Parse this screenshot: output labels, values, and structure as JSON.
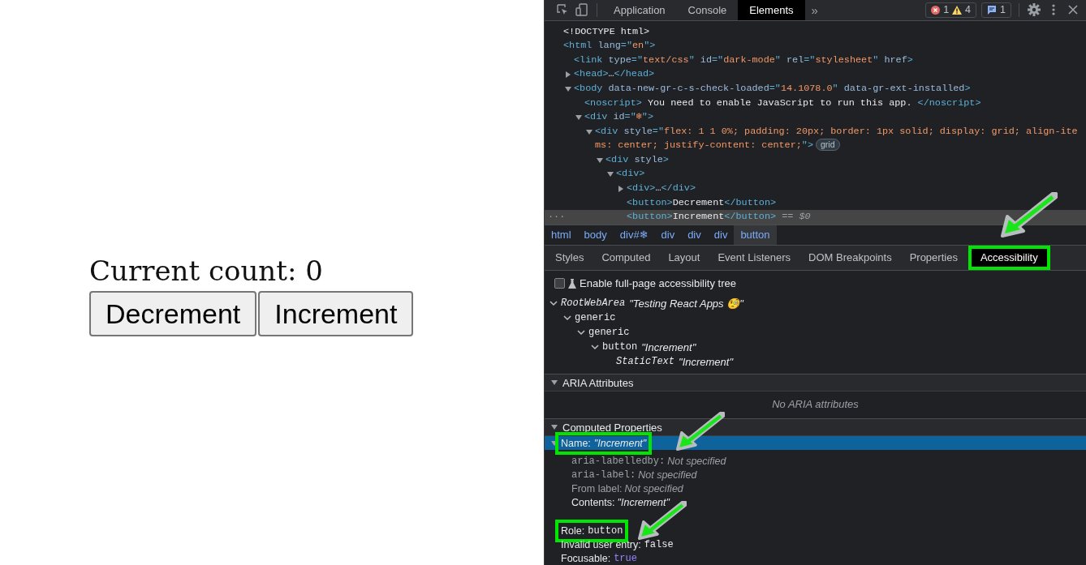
{
  "app": {
    "count_text": "Current count: 0",
    "buttons": [
      {
        "label": "Decrement"
      },
      {
        "label": "Increment"
      }
    ]
  },
  "devtools": {
    "tabs": [
      {
        "label": "Application",
        "selected": false
      },
      {
        "label": "Console",
        "selected": false
      },
      {
        "label": "Elements",
        "selected": true
      }
    ],
    "more_tabs": "»",
    "issues": {
      "errors": "1",
      "warnings": "4",
      "messages": "1"
    },
    "dom_tree": [
      {
        "parts": [
          {
            "kind": "text",
            "text": "<!DOCTYPE html>"
          }
        ]
      },
      {
        "parts": [
          {
            "kind": "tag",
            "text": "<html"
          },
          {
            "kind": "attr",
            "text": " lang"
          },
          {
            "kind": "tag",
            "text": "=\""
          },
          {
            "kind": "value",
            "text": "en"
          },
          {
            "kind": "tag",
            "text": "\">"
          }
        ],
        "children": [
          {
            "parts": [
              {
                "kind": "tag",
                "text": "<link"
              },
              {
                "kind": "attr",
                "text": " type"
              },
              {
                "kind": "tag",
                "text": "=\""
              },
              {
                "kind": "value",
                "text": "text/css"
              },
              {
                "kind": "tag",
                "text": "\""
              },
              {
                "kind": "attr",
                "text": " id"
              },
              {
                "kind": "tag",
                "text": "=\""
              },
              {
                "kind": "value",
                "text": "dark-mode"
              },
              {
                "kind": "tag",
                "text": "\""
              },
              {
                "kind": "attr",
                "text": " rel"
              },
              {
                "kind": "tag",
                "text": "=\""
              },
              {
                "kind": "value",
                "text": "stylesheet"
              },
              {
                "kind": "tag",
                "text": "\""
              },
              {
                "kind": "attr",
                "text": " href"
              },
              {
                "kind": "tag",
                "text": ">"
              }
            ]
          },
          {
            "expanded": false,
            "parts": [
              {
                "kind": "tag",
                "text": "<head>"
              },
              {
                "kind": "text",
                "text": "…"
              },
              {
                "kind": "tag",
                "text": "</head>"
              }
            ]
          },
          {
            "expanded": true,
            "parts": [
              {
                "kind": "tag",
                "text": "<body"
              },
              {
                "kind": "attr",
                "text": " data-new-gr-c-s-check-loaded"
              },
              {
                "kind": "tag",
                "text": "=\""
              },
              {
                "kind": "value",
                "text": "14.1078.0"
              },
              {
                "kind": "tag",
                "text": "\""
              },
              {
                "kind": "attr",
                "text": " data-gr-ext-installed"
              },
              {
                "kind": "tag",
                "text": ">"
              }
            ],
            "children": [
              {
                "parts": [
                  {
                    "kind": "tag",
                    "text": "<noscript>"
                  },
                  {
                    "kind": "text",
                    "text": " You need to enable JavaScript to run this app. "
                  },
                  {
                    "kind": "tag",
                    "text": "</noscript>"
                  }
                ]
              },
              {
                "expanded": true,
                "parts": [
                  {
                    "kind": "tag",
                    "text": "<div"
                  },
                  {
                    "kind": "attr",
                    "text": " id"
                  },
                  {
                    "kind": "tag",
                    "text": "=\""
                  },
                  {
                    "kind": "value",
                    "text": "❄"
                  },
                  {
                    "kind": "tag",
                    "text": "\">"
                  }
                ],
                "children": [
                  {
                    "expanded": true,
                    "parts": [
                      {
                        "kind": "tag",
                        "text": "<div"
                      },
                      {
                        "kind": "attr",
                        "text": " style"
                      },
                      {
                        "kind": "tag",
                        "text": "=\""
                      },
                      {
                        "kind": "value",
                        "text": "flex: 1 1 0%; padding: 20px; border: 1px solid; display: grid; align-items: center; justify-content: center;"
                      },
                      {
                        "kind": "tag",
                        "text": "\">"
                      },
                      {
                        "kind": "badge",
                        "text": "grid"
                      }
                    ],
                    "children": [
                      {
                        "expanded": true,
                        "parts": [
                          {
                            "kind": "tag",
                            "text": "<div"
                          },
                          {
                            "kind": "attr",
                            "text": " style"
                          },
                          {
                            "kind": "tag",
                            "text": ">"
                          }
                        ],
                        "children": [
                          {
                            "expanded": true,
                            "parts": [
                              {
                                "kind": "tag",
                                "text": "<div>"
                              }
                            ],
                            "children": [
                              {
                                "expanded": false,
                                "parts": [
                                  {
                                    "kind": "tag",
                                    "text": "<div>"
                                  },
                                  {
                                    "kind": "text",
                                    "text": "…"
                                  },
                                  {
                                    "kind": "tag",
                                    "text": "</div>"
                                  }
                                ]
                              },
                              {
                                "parts": [
                                  {
                                    "kind": "tag",
                                    "text": "<button>"
                                  },
                                  {
                                    "kind": "text",
                                    "text": "Decrement"
                                  },
                                  {
                                    "kind": "tag",
                                    "text": "</button>"
                                  }
                                ]
                              },
                              {
                                "selected": true,
                                "gutter": "···",
                                "parts": [
                                  {
                                    "kind": "tag",
                                    "text": "<button>"
                                  },
                                  {
                                    "kind": "text",
                                    "text": "Increment"
                                  },
                                  {
                                    "kind": "tag",
                                    "text": "</button>"
                                  },
                                  {
                                    "kind": "dim",
                                    "text": " == $0"
                                  }
                                ]
                              }
                            ]
                          }
                        ]
                      }
                    ]
                  }
                ]
              }
            ]
          }
        ]
      }
    ],
    "breadcrumbs": [
      {
        "label": "html",
        "selected": false
      },
      {
        "label": "body",
        "selected": false
      },
      {
        "label": "div#❄",
        "selected": false
      },
      {
        "label": "div",
        "selected": false
      },
      {
        "label": "div",
        "selected": false
      },
      {
        "label": "div",
        "selected": false
      },
      {
        "label": "button",
        "selected": true
      }
    ],
    "subtabs": [
      {
        "label": "Styles",
        "selected": false
      },
      {
        "label": "Computed",
        "selected": false
      },
      {
        "label": "Layout",
        "selected": false
      },
      {
        "label": "Event Listeners",
        "selected": false
      },
      {
        "label": "DOM Breakpoints",
        "selected": false
      },
      {
        "label": "Properties",
        "selected": false
      },
      {
        "label": "Accessibility",
        "selected": true,
        "highlighted": true
      }
    ],
    "accessibility": {
      "full_page_tree": {
        "label": "Enable full-page accessibility tree",
        "checked": false
      },
      "tree": [
        {
          "role": "RootWebArea",
          "italic": true,
          "name": "\"Testing React Apps 🧐\"",
          "children": [
            {
              "role": "generic",
              "italic": false,
              "children": [
                {
                  "role": "generic",
                  "italic": false,
                  "children": [
                    {
                      "role": "button",
                      "italic": false,
                      "name": "\"Increment\"",
                      "children": [
                        {
                          "role": "StaticText",
                          "italic": true,
                          "name": "\"Increment\""
                        }
                      ]
                    }
                  ]
                }
              ]
            }
          ]
        }
      ],
      "aria_section": {
        "title": "ARIA Attributes",
        "expanded": true,
        "empty_text": "No ARIA attributes"
      },
      "computed_section": {
        "title": "Computed Properties",
        "expanded": true,
        "properties": [
          {
            "label": "Name:",
            "value": "\"Increment\"",
            "monospace": false,
            "keyword": false,
            "selected": true,
            "highlighted": true,
            "expanded": true,
            "sources": [
              {
                "label": "aria-labelledby:",
                "monospace": true,
                "value": "Not specified",
                "active": false
              },
              {
                "label": "aria-label:",
                "monospace": true,
                "value": "Not specified",
                "active": false
              },
              {
                "label": "From label:",
                "monospace": false,
                "value": "Not specified",
                "active": false
              },
              {
                "label": "Contents:",
                "monospace": false,
                "value": "\"Increment\"",
                "active": true
              }
            ]
          },
          {
            "label": "Role:",
            "value": "button",
            "monospace": true,
            "keyword": false,
            "selected": false,
            "highlighted": true
          },
          {
            "label": "Invalid user entry:",
            "value": "false",
            "monospace": true,
            "keyword": false,
            "selected": false,
            "highlighted": false
          },
          {
            "label": "Focusable:",
            "value": "true",
            "monospace": true,
            "keyword": true,
            "selected": false,
            "highlighted": false
          }
        ]
      }
    }
  }
}
